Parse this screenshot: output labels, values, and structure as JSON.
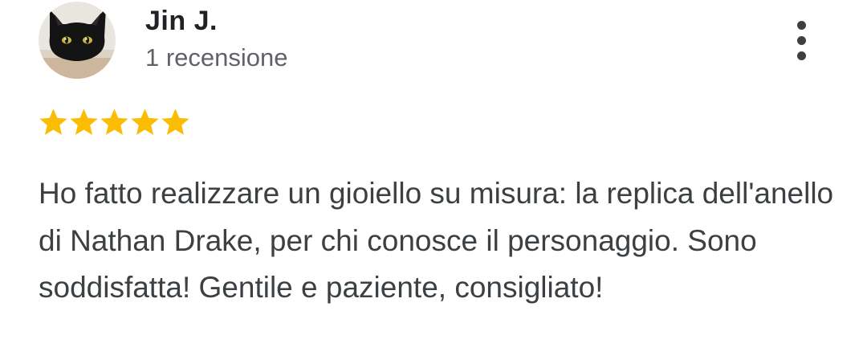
{
  "review": {
    "author": {
      "name": "Jin J.",
      "meta": "1 recensione"
    },
    "rating": 5,
    "rating_max": 5,
    "star_color": "#fbbc04",
    "text": "Ho fatto realizzare un gioiello su misura: la replica dell'anello di Nathan Drake, per chi conosce il personaggio. Sono soddisfatta! Gentile e paziente, consigliato!"
  },
  "icons": {
    "avatar": "black-cat-photo",
    "menu": "more-vert-icon",
    "star": "star-icon"
  }
}
